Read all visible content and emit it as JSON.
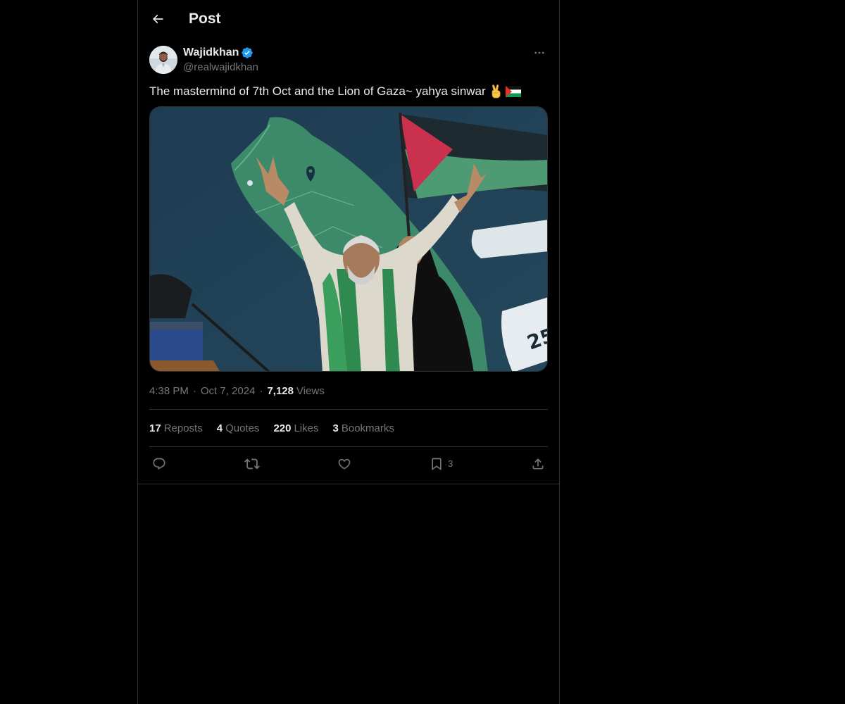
{
  "header": {
    "title": "Post"
  },
  "author": {
    "display_name": "Wajidkhan",
    "handle": "@realwajidkhan",
    "verified": true
  },
  "post": {
    "text": "The mastermind of 7th Oct and the Lion of Gaza~ yahya sinwar",
    "emojis": [
      "victory-hand",
      "flag-palestine"
    ],
    "media_alt": "Image"
  },
  "meta": {
    "time": "4:38 PM",
    "date": "Oct 7, 2024",
    "views_count": "7,128",
    "views_label": "Views"
  },
  "stats": [
    {
      "count": "17",
      "label": "Reposts"
    },
    {
      "count": "4",
      "label": "Quotes"
    },
    {
      "count": "220",
      "label": "Likes"
    },
    {
      "count": "3",
      "label": "Bookmarks"
    }
  ],
  "actions": {
    "bookmark_count": "3"
  },
  "colors": {
    "background": "#000000",
    "text": "#e7e9ea",
    "secondary_text": "#71767b",
    "border": "#2f3336",
    "verified_blue": "#1d9bf0"
  }
}
